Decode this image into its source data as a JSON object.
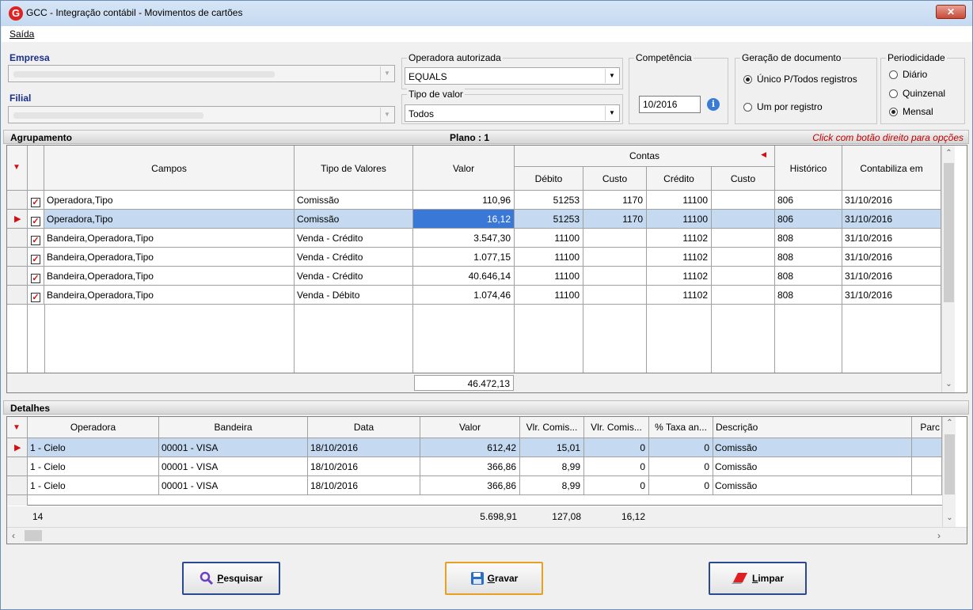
{
  "window": {
    "title": "GCC - Integração contábil - Movimentos de cartões",
    "logo": "G",
    "close": "✕"
  },
  "menu": {
    "saida": "Saída"
  },
  "filters": {
    "empresa_label": "Empresa",
    "filial_label": "Filial",
    "operadora_label": "Operadora autorizada",
    "operadora_value": "EQUALS",
    "tipo_label": "Tipo de valor",
    "tipo_value": "Todos",
    "competencia_label": "Competência",
    "competencia_value": "10/2016",
    "geracao_label": "Geração de documento",
    "geracao_opt1": "Único P/Todos registros",
    "geracao_opt2": "Um por registro",
    "periodicidade_label": "Periodicidade",
    "per_opt1": "Diário",
    "per_opt2": "Quinzenal",
    "per_opt3": "Mensal"
  },
  "agrupamento": {
    "title": "Agrupamento",
    "plano": "Plano : 1",
    "hint": "Click com botão direito para opções",
    "headers": {
      "campos": "Campos",
      "tipo": "Tipo de Valores",
      "valor": "Valor",
      "contas": "Contas",
      "debito": "Débito",
      "custo1": "Custo",
      "credito": "Crédito",
      "custo2": "Custo",
      "historico": "Histórico",
      "contabiliza": "Contabiliza em"
    },
    "rows": [
      {
        "campos": "Operadora,Tipo",
        "tipo": "Comissão",
        "valor": "110,96",
        "debito": "51253",
        "custo1": "1170",
        "credito": "11100",
        "custo2": "",
        "historico": "806",
        "contabiliza": "31/10/2016"
      },
      {
        "campos": "Operadora,Tipo",
        "tipo": "Comissão",
        "valor": "16,12",
        "debito": "51253",
        "custo1": "1170",
        "credito": "11100",
        "custo2": "",
        "historico": "806",
        "contabiliza": "31/10/2016"
      },
      {
        "campos": "Bandeira,Operadora,Tipo",
        "tipo": "Venda - Crédito",
        "valor": "3.547,30",
        "debito": "11100",
        "custo1": "",
        "credito": "11102",
        "custo2": "",
        "historico": "808",
        "contabiliza": "31/10/2016"
      },
      {
        "campos": "Bandeira,Operadora,Tipo",
        "tipo": "Venda - Crédito",
        "valor": "1.077,15",
        "debito": "11100",
        "custo1": "",
        "credito": "11102",
        "custo2": "",
        "historico": "808",
        "contabiliza": "31/10/2016"
      },
      {
        "campos": "Bandeira,Operadora,Tipo",
        "tipo": "Venda - Crédito",
        "valor": "40.646,14",
        "debito": "11100",
        "custo1": "",
        "credito": "11102",
        "custo2": "",
        "historico": "808",
        "contabiliza": "31/10/2016"
      },
      {
        "campos": "Bandeira,Operadora,Tipo",
        "tipo": "Venda - Débito",
        "valor": "1.074,46",
        "debito": "11100",
        "custo1": "",
        "credito": "11102",
        "custo2": "",
        "historico": "808",
        "contabiliza": "31/10/2016"
      }
    ],
    "total": "46.472,13"
  },
  "detalhes": {
    "title": "Detalhes",
    "headers": {
      "operadora": "Operadora",
      "bandeira": "Bandeira",
      "data": "Data",
      "valor": "Valor",
      "vlr1": "Vlr. Comis...",
      "vlr2": "Vlr. Comis...",
      "taxa": "% Taxa an...",
      "descricao": "Descrição",
      "parc": "Parc"
    },
    "rows": [
      {
        "operadora": "1 - Cielo",
        "bandeira": "00001 - VISA",
        "data": "18/10/2016",
        "valor": "612,42",
        "vlr1": "15,01",
        "vlr2": "0",
        "taxa": "0",
        "descricao": "Comissão"
      },
      {
        "operadora": "1 - Cielo",
        "bandeira": "00001 - VISA",
        "data": "18/10/2016",
        "valor": "366,86",
        "vlr1": "8,99",
        "vlr2": "0",
        "taxa": "0",
        "descricao": "Comissão"
      },
      {
        "operadora": "1 - Cielo",
        "bandeira": "00001 - VISA",
        "data": "18/10/2016",
        "valor": "366,86",
        "vlr1": "8,99",
        "vlr2": "0",
        "taxa": "0",
        "descricao": "Comissão"
      }
    ],
    "footer": {
      "count": "14",
      "valor": "5.698,91",
      "vlr1": "127,08",
      "vlr2": "16,12"
    }
  },
  "buttons": {
    "pesquisar_u": "P",
    "pesquisar_rest": "esquisar",
    "gravar_u": "G",
    "gravar_rest": "ravar",
    "limpar_u": "L",
    "limpar_rest": "impar"
  },
  "icons": {
    "search": "search-icon",
    "save": "floppy-disk-icon",
    "clear": "eraser-icon",
    "info": "info-icon"
  },
  "colors": {
    "selected_row": "#c5d9f1",
    "hint_red": "#c00000",
    "label_blue": "#1a2f8a",
    "button_border": "#2b4a8d"
  }
}
